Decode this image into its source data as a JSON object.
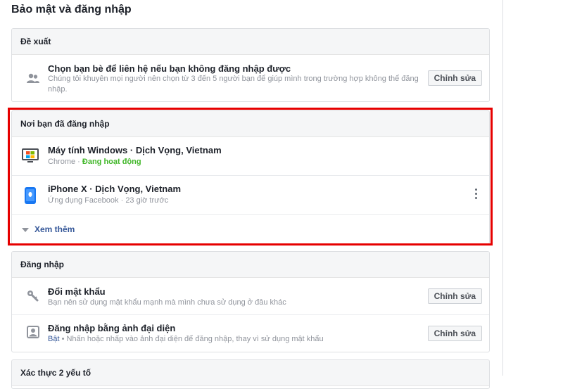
{
  "page_title": "Bảo mật và đăng nhập",
  "colors": {
    "accent_red_highlight": "#e60000",
    "active_green": "#42b72a",
    "link_blue": "#365899"
  },
  "recommended": {
    "header": "Đề xuất",
    "item": {
      "icon": "friends-icon",
      "title": "Chọn bạn bè để liên hệ nếu bạn không đăng nhập được",
      "description": "Chúng tôi khuyên mọi người nên chọn từ 3 đến 5 người bạn để giúp mình trong trường hợp không thể đăng nhập.",
      "button": "Chỉnh sửa"
    }
  },
  "where_logged_in": {
    "header": "Nơi bạn đã đăng nhập",
    "sessions": [
      {
        "icon": "windows-desktop-icon",
        "title": "Máy tính Windows · Dịch Vọng, Vietnam",
        "app": "Chrome",
        "separator": " · ",
        "status": "Đang hoạt động"
      },
      {
        "icon": "iphone-icon",
        "title": "iPhone X · Dịch Vọng, Vietnam",
        "app": "Ứng dụng Facebook",
        "separator": " · ",
        "status": "23 giờ trước"
      }
    ],
    "see_more": "Xem thêm"
  },
  "login": {
    "header": "Đăng nhập",
    "items": [
      {
        "icon": "key-icon",
        "title": "Đổi mật khẩu",
        "description": "Bạn nên sử dụng mật khẩu mạnh mà mình chưa sử dụng ở đâu khác",
        "button": "Chỉnh sửa"
      },
      {
        "icon": "profile-picture-icon",
        "title": "Đăng nhập bằng ảnh đại diện",
        "status": "Bật",
        "description": " • Nhấn hoặc nhấp vào ảnh đại diện để đăng nhập, thay vì sử dụng mật khẩu",
        "button": "Chỉnh sửa"
      }
    ]
  },
  "two_factor": {
    "header": "Xác thực 2 yếu tố"
  }
}
